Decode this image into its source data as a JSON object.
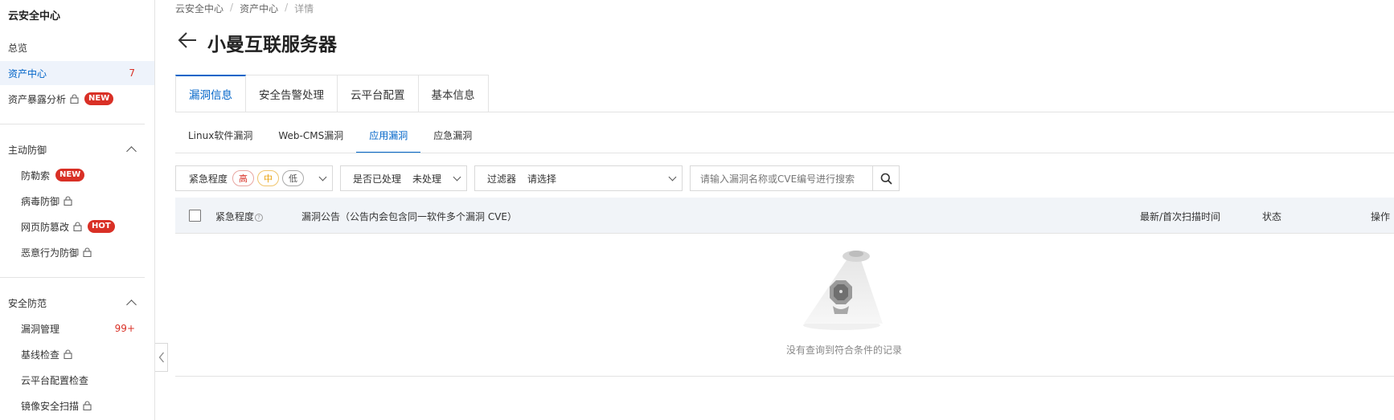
{
  "sidebar": {
    "title": "云安全中心",
    "items": [
      {
        "label": "总览"
      },
      {
        "label": "资产中心",
        "count": "7"
      },
      {
        "label": "资产暴露分析",
        "badge": "NEW"
      }
    ],
    "groups": [
      {
        "label": "主动防御",
        "items": [
          {
            "label": "防勒索",
            "badge": "NEW"
          },
          {
            "label": "病毒防御"
          },
          {
            "label": "网页防篡改",
            "badge": "HOT"
          },
          {
            "label": "恶意行为防御"
          }
        ]
      },
      {
        "label": "安全防范",
        "items": [
          {
            "label": "漏洞管理",
            "count": "99+"
          },
          {
            "label": "基线检查"
          },
          {
            "label": "云平台配置检查"
          },
          {
            "label": "镜像安全扫描"
          }
        ]
      }
    ]
  },
  "breadcrumb": [
    "云安全中心",
    "资产中心",
    "详情"
  ],
  "page_title": "小曼互联服务器",
  "tabs": [
    {
      "label": "漏洞信息"
    },
    {
      "label": "安全告警处理"
    },
    {
      "label": "云平台配置"
    },
    {
      "label": "基本信息"
    }
  ],
  "subtabs": [
    {
      "label": "Linux软件漏洞"
    },
    {
      "label": "Web-CMS漏洞"
    },
    {
      "label": "应用漏洞"
    },
    {
      "label": "应急漏洞"
    }
  ],
  "filters": {
    "urgency_label": "紧急程度",
    "urgency_high": "高",
    "urgency_mid": "中",
    "urgency_low": "低",
    "processed_label": "是否已处理",
    "processed_value": "未处理",
    "filter_label": "过滤器",
    "filter_placeholder": "请选择",
    "search_placeholder": "请输入漏洞名称或CVE编号进行搜索"
  },
  "table": {
    "col_urgency": "紧急程度",
    "col_notice": "漏洞公告（公告内会包含同一软件多个漏洞 CVE）",
    "col_time": "最新/首次扫描时间",
    "col_status": "状态",
    "col_action": "操作",
    "empty_text": "没有查询到符合条件的记录"
  },
  "colors": {
    "accent": "#0064c8",
    "badge_red": "#d93026",
    "urgency_high": "#d93026",
    "urgency_mid": "#e8a00b"
  }
}
